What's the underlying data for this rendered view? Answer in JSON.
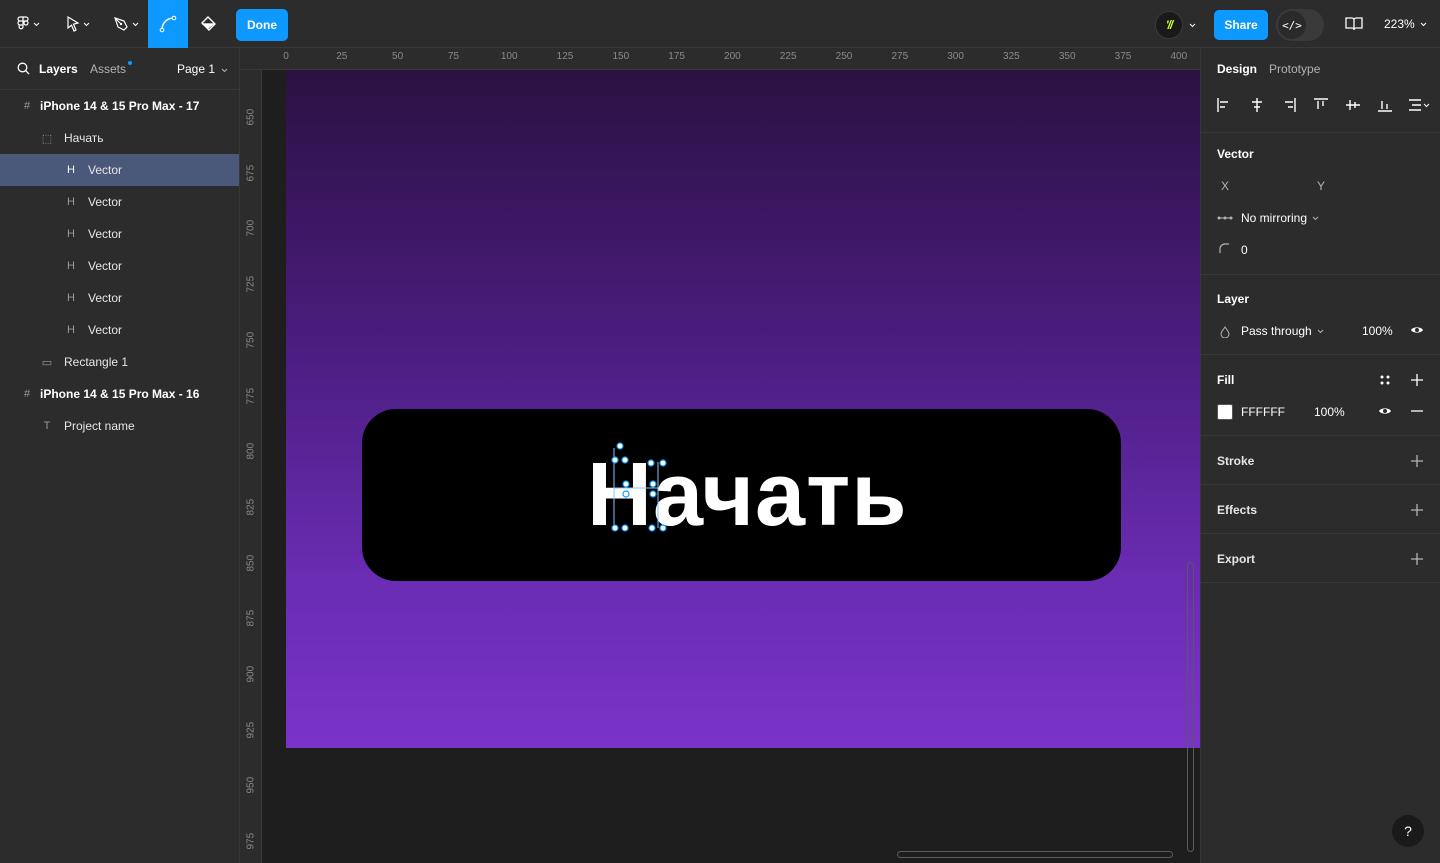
{
  "toolbar": {
    "done_label": "Done",
    "share_label": "Share",
    "avatar_initials": "'//",
    "devmode_label": "</>",
    "zoom": "223%"
  },
  "left_panel": {
    "tab_layers": "Layers",
    "tab_assets": "Assets",
    "page": "Page 1",
    "layers": [
      {
        "name": "iPhone 14 & 15 Pro Max - 17",
        "icon": "frame-icon",
        "bold": true
      },
      {
        "name": "Начать",
        "icon": "group-icon",
        "bold": false
      },
      {
        "name": "Vector",
        "icon": "vector-glyph-icon",
        "bold": false,
        "selected": true
      },
      {
        "name": "Vector",
        "icon": "vector-glyph-icon",
        "bold": false
      },
      {
        "name": "Vector",
        "icon": "vector-glyph-icon",
        "bold": false
      },
      {
        "name": "Vector",
        "icon": "vector-glyph-icon",
        "bold": false
      },
      {
        "name": "Vector",
        "icon": "vector-glyph-icon",
        "bold": false
      },
      {
        "name": "Vector",
        "icon": "vector-glyph-icon",
        "bold": false
      },
      {
        "name": "Rectangle 1",
        "icon": "rectangle-icon",
        "bold": false
      },
      {
        "name": "iPhone 14 & 15 Pro Max - 16",
        "icon": "frame-icon",
        "bold": true
      },
      {
        "name": "Project name",
        "icon": "text-icon",
        "bold": false
      }
    ]
  },
  "rulers": {
    "top": [
      "0",
      "25",
      "50",
      "75",
      "100",
      "125",
      "150",
      "175",
      "200",
      "225",
      "250",
      "275",
      "300",
      "325",
      "350",
      "375",
      "400"
    ],
    "left": [
      "650",
      "675",
      "700",
      "725",
      "750",
      "775",
      "800",
      "825",
      "850",
      "875",
      "900",
      "925",
      "950",
      "975"
    ]
  },
  "canvas": {
    "button_text": "Начать",
    "frame_gradient_top": "#2b1142",
    "frame_gradient_bottom": "#7a33c8"
  },
  "right_panel": {
    "tab_design": "Design",
    "tab_prototype": "Prototype",
    "vector": {
      "title": "Vector",
      "x_label": "X",
      "y_label": "Y",
      "mirroring": "No mirroring",
      "corner_radius": "0"
    },
    "layer": {
      "title": "Layer",
      "blend": "Pass through",
      "opacity": "100%"
    },
    "fill": {
      "title": "Fill",
      "hex": "FFFFFF",
      "opacity": "100%",
      "color": "#ffffff"
    },
    "stroke_title": "Stroke",
    "effects_title": "Effects",
    "export_title": "Export"
  },
  "help_label": "?",
  "colors": {
    "accent": "#0d99ff",
    "selected_row": "#4a5879",
    "panel_bg": "#2c2c2c",
    "canvas_bg": "#1e1e1e"
  }
}
